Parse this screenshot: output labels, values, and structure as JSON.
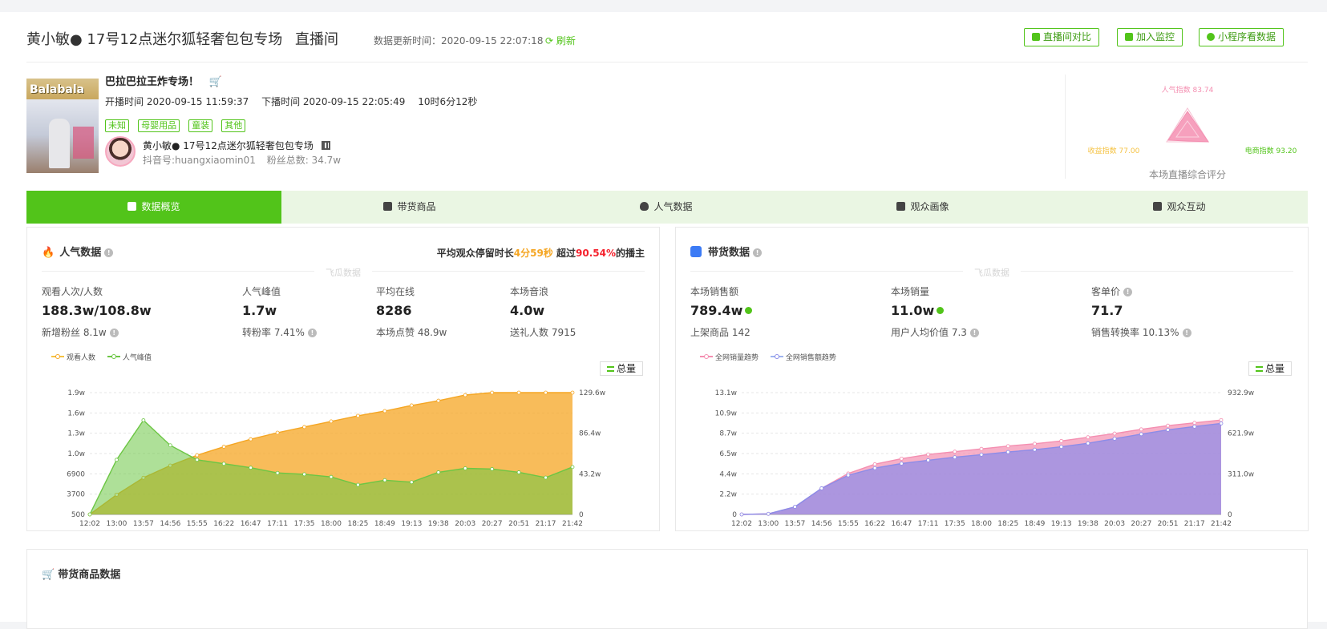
{
  "header": {
    "title": "黄小敏● 17号12点迷尔狐轻奢包包专场",
    "subtitle": "直播间",
    "update_label": "数据更新时间：2020-09-15 22:07:18",
    "refresh": "刷新",
    "buttons": [
      "直播间对比",
      "加入监控",
      "小程序看数据"
    ]
  },
  "live": {
    "thumb_text": "Balabala",
    "title": "巴拉巴拉王炸专场！",
    "start": "开播时间 2020-09-15 11:59:37",
    "end": "下播时间 2020-09-15 22:05:49",
    "duration": "10时6分12秒",
    "tags": [
      "未知",
      "母婴用品",
      "童装",
      "其他"
    ],
    "anchor_name": "黄小敏● 17号12点迷尔狐轻奢包包专场",
    "douyin_id": "抖音号:huangxiaomin01",
    "fans": "粉丝总数: 34.7w"
  },
  "radar": {
    "top": "人气指数 83.74",
    "left": "收益指数 77.00",
    "right": "电商指数 93.20",
    "caption": "本场直播综合评分",
    "values": {
      "popularity": 83.74,
      "revenue": 77.0,
      "ecommerce": 93.2
    },
    "colors": {
      "pink": "#f48fb1",
      "yellow": "#f5c242",
      "green": "#52c41a"
    }
  },
  "tabs": [
    "数据概览",
    "带货商品",
    "人气数据",
    "观众画像",
    "观众互动"
  ],
  "popularity": {
    "title": "人气数据",
    "stay_pre": "平均观众停留时长",
    "stay_val": "4分59秒",
    "stay_mid": " 超过",
    "stay_pct": "90.54%",
    "stay_post": "的播主",
    "watermark": "飞瓜数据",
    "metrics": [
      {
        "label": "观看人次/人数",
        "value": "188.3w/108.8w",
        "sub": "新增粉丝 8.1w"
      },
      {
        "label": "人气峰值",
        "value": "1.7w",
        "sub": "转粉率 7.41%"
      },
      {
        "label": "平均在线",
        "value": "8286",
        "sub": "本场点赞 48.9w"
      },
      {
        "label": "本场音浪",
        "value": "4.0w",
        "sub": "送礼人数 7915"
      }
    ],
    "legend": [
      "观看人数",
      "人气峰值"
    ],
    "total": "总量"
  },
  "sales": {
    "title": "带货数据",
    "watermark": "飞瓜数据",
    "metrics": [
      {
        "label": "本场销售额",
        "value": "789.4w",
        "sub": "上架商品 142"
      },
      {
        "label": "本场销量",
        "value": "11.0w",
        "sub": "用户人均价值 7.3"
      },
      {
        "label": "客单价",
        "value": "71.7",
        "sub": "销售转换率 10.13%"
      }
    ],
    "legend": [
      "全网销量趋势",
      "全网销售额趋势"
    ],
    "total": "总量"
  },
  "goods_section": {
    "title": "带货商品数据"
  },
  "chart_data": [
    {
      "type": "area",
      "x": [
        "12:02",
        "13:00",
        "13:57",
        "14:56",
        "15:55",
        "16:22",
        "16:47",
        "17:11",
        "17:35",
        "18:00",
        "18:25",
        "18:49",
        "19:13",
        "19:38",
        "20:03",
        "20:27",
        "20:51",
        "21:17",
        "21:42"
      ],
      "y_left_ticks": [
        "500",
        "3700",
        "6900",
        "1.0w",
        "1.3w",
        "1.6w",
        "1.9w"
      ],
      "y_right_ticks": [
        "0",
        "43.2w",
        "86.4w",
        "129.6w"
      ],
      "series": [
        {
          "name": "观看人数",
          "axis": "right",
          "color": "#f5a623",
          "values": [
            0,
            210000,
            390000,
            520000,
            630000,
            720000,
            800000,
            870000,
            930000,
            990000,
            1050000,
            1100000,
            1160000,
            1210000,
            1270000,
            1320000,
            1370000,
            1420000,
            1480000
          ]
        },
        {
          "name": "人气峰值",
          "axis": "left",
          "color": "#6cc644",
          "values": [
            500,
            8800,
            14800,
            11000,
            8800,
            8200,
            7600,
            6800,
            6600,
            6200,
            5000,
            5700,
            5400,
            6900,
            7500,
            7400,
            6900,
            6100,
            7700
          ]
        }
      ],
      "left_range": [
        500,
        19000
      ],
      "right_range": [
        0,
        1296000
      ]
    },
    {
      "type": "area",
      "x": [
        "12:02",
        "13:00",
        "13:57",
        "14:56",
        "15:55",
        "16:22",
        "16:47",
        "17:11",
        "17:35",
        "18:00",
        "18:25",
        "18:49",
        "19:13",
        "19:38",
        "20:03",
        "20:27",
        "20:51",
        "21:17",
        "21:42"
      ],
      "y_left_ticks": [
        "0",
        "2.2w",
        "4.4w",
        "6.5w",
        "8.7w",
        "10.9w",
        "13.1w"
      ],
      "y_right_ticks": [
        "0",
        "311.0w",
        "621.9w",
        "932.9w"
      ],
      "series": [
        {
          "name": "全网销量趋势",
          "axis": "left",
          "color": "#f48fb1",
          "values": [
            0,
            600,
            8000,
            28000,
            44000,
            54000,
            60000,
            64500,
            67500,
            70500,
            73500,
            76000,
            79000,
            83000,
            87000,
            91500,
            95500,
            98500,
            101500
          ]
        },
        {
          "name": "全网销售额趋势",
          "axis": "right",
          "color": "#8c8ce8",
          "values": [
            0,
            45000,
            580000,
            2000000,
            3000000,
            3550000,
            3900000,
            4150000,
            4380000,
            4580000,
            4780000,
            4960000,
            5180000,
            5450000,
            5800000,
            6150000,
            6480000,
            6730000,
            6970000
          ]
        }
      ],
      "left_range": [
        0,
        131000
      ],
      "right_range": [
        0,
        9329000
      ]
    }
  ]
}
